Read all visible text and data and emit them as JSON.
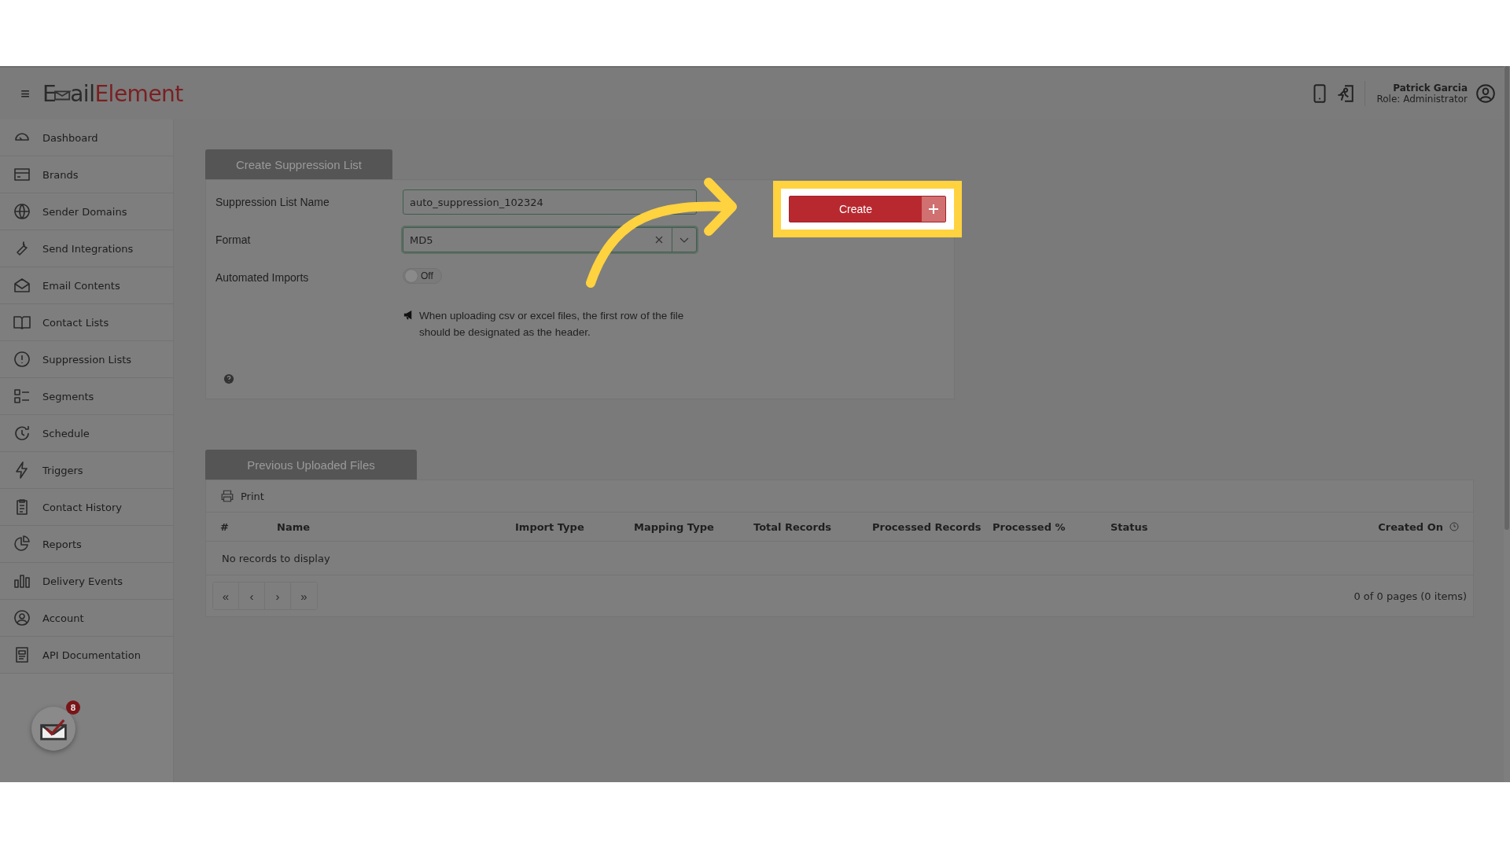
{
  "header": {
    "menu_glyph": "≡",
    "logo": {
      "part1": "E",
      "part2": "ail",
      "part3": "Element"
    },
    "user": {
      "name": "Patrick Garcia",
      "role": "Role: Administrator"
    }
  },
  "sidebar": {
    "items": [
      {
        "label": "Dashboard"
      },
      {
        "label": "Brands"
      },
      {
        "label": "Sender Domains"
      },
      {
        "label": "Send Integrations"
      },
      {
        "label": "Email Contents"
      },
      {
        "label": "Contact Lists"
      },
      {
        "label": "Suppression Lists"
      },
      {
        "label": "Segments"
      },
      {
        "label": "Schedule"
      },
      {
        "label": "Triggers"
      },
      {
        "label": "Contact History"
      },
      {
        "label": "Reports"
      },
      {
        "label": "Delivery Events"
      },
      {
        "label": "Account"
      },
      {
        "label": "API Documentation"
      }
    ],
    "notification_badge": "8"
  },
  "form": {
    "tab": "Create Suppression List",
    "name_label": "Suppression List Name",
    "name_value": "auto_suppression_102324",
    "format_label": "Format",
    "format_value": "MD5",
    "imports_label": "Automated Imports",
    "imports_toggle": {
      "on": false,
      "label": "Off"
    },
    "notice": "When uploading csv or excel files, the first row of the file should be designated as the header.",
    "create_button": "Create"
  },
  "uploads": {
    "tab": "Previous Uploaded Files",
    "print": "Print",
    "columns": [
      "#",
      "Name",
      "Import Type",
      "Mapping Type",
      "Total Records",
      "Processed Records",
      "Processed %",
      "Status",
      "Created On"
    ],
    "empty": "No records to display",
    "pager": [
      "«",
      "‹",
      "›",
      "»"
    ],
    "page_info": "0 of 0 pages (0 items)"
  }
}
